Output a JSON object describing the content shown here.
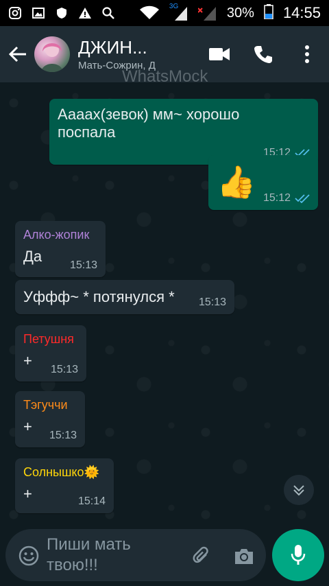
{
  "status_bar": {
    "network_badge_1": "3G",
    "battery": "30%",
    "time": "14:55"
  },
  "header": {
    "title": "ДЖИН...",
    "subtitle": "Мать-Сожрин, Д",
    "watermark": "WhatsMock"
  },
  "messages": [
    {
      "direction": "out",
      "text": "Ааааx(зевок) мм~ хорошо поспала",
      "time": "15:12",
      "status": "read"
    },
    {
      "direction": "out",
      "text": "👍",
      "time": "15:12",
      "status": "read"
    },
    {
      "direction": "in",
      "sender": "Алко-жопик",
      "sender_color": "#b082d8",
      "text": "Да",
      "time": "15:13"
    },
    {
      "direction": "in",
      "text": "Уффф~ * потянулся *",
      "time": "15:13"
    },
    {
      "direction": "in",
      "sender": "Петушня",
      "sender_color": "#ff2a2a",
      "text": "+",
      "time": "15:13"
    },
    {
      "direction": "in",
      "sender": "Тэгуччи",
      "sender_color": "#ff8c1a",
      "text": "+",
      "time": "15:13"
    },
    {
      "direction": "in",
      "sender": "Солнышко🌞",
      "sender_color": "#ffd60a",
      "text": "+",
      "time": "15:14"
    }
  ],
  "input": {
    "placeholder": "Пиши мать твою!!!"
  },
  "colors": {
    "header_bg": "#1f2c34",
    "outgoing_bubble": "#005c4b",
    "incoming_bubble": "#1f2c34",
    "read_ticks": "#53bdeb",
    "mic_button": "#00a884"
  }
}
